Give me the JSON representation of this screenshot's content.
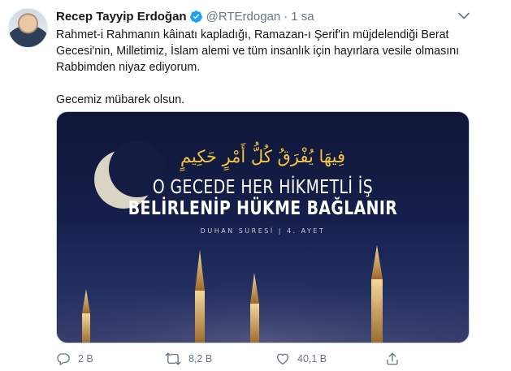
{
  "author": {
    "name": "Recep Tayyip Erdoğan",
    "handle": "@RTErdogan",
    "separator": "·",
    "time": "1 sa",
    "verified": true
  },
  "tweet": {
    "paragraph1": "Rahmet-i Rahmanın kâinatı kapladığı, Ramazan-ı Şerif'in müjdelendiği Berat Gecesi'nin, Milletimiz, İslam alemi ve tüm insanlık için hayırlara vesile olmasını Rabbimden niyaz ediyorum.",
    "paragraph2": "Gecemiz mübarek olsun."
  },
  "media": {
    "arabic": "فِيهَا يُفْرَقُ كُلُّ أَمْرٍ حَكِيمٍ",
    "line1": "O GECEDE HER HİKMETLİ İŞ",
    "line2": "BELİRLENİP HÜKME BAĞLANIR",
    "source": "DUHAN SURESİ | 4. AYET"
  },
  "actions": {
    "replies": "2 B",
    "retweets": "8,2 B",
    "likes": "40,1 B"
  },
  "icons": {
    "verified": "verified-badge-icon",
    "caret": "chevron-down-icon",
    "reply": "reply-icon",
    "retweet": "retweet-icon",
    "like": "heart-icon",
    "share": "share-icon"
  },
  "colors": {
    "verified": "#1da1f2",
    "secondary_text": "#657786",
    "accent_gold": "#f4c542"
  }
}
